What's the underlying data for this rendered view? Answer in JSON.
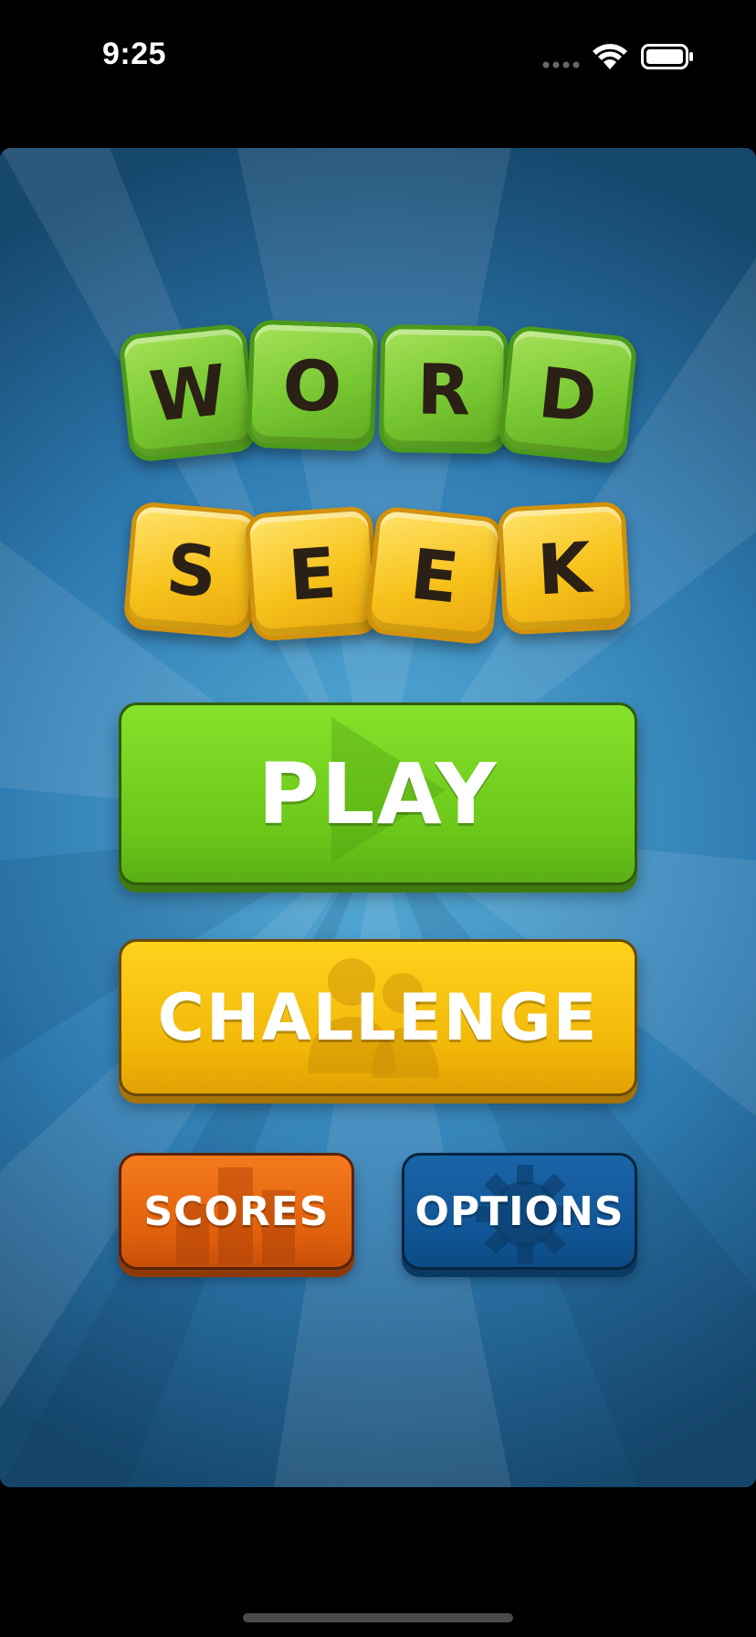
{
  "status_bar": {
    "time": "9:25",
    "icons": [
      "cellular-signal-icon",
      "wifi-icon",
      "battery-icon"
    ]
  },
  "logo": {
    "row1": [
      "W",
      "O",
      "R",
      "D"
    ],
    "row2": [
      "S",
      "E",
      "E",
      "K"
    ],
    "row1_color": "#78c832",
    "row2_color": "#f7c21c"
  },
  "buttons": {
    "play": {
      "label": "PLAY",
      "icon": "play-triangle-icon",
      "color": "#6bc81a"
    },
    "challenge": {
      "label": "CHALLENGE",
      "icon": "people-icon",
      "color": "#f2b708"
    },
    "scores": {
      "label": "SCORES",
      "icon": "bar-chart-icon",
      "color": "#e0600c"
    },
    "options": {
      "label": "OPTIONS",
      "icon": "gear-icon",
      "color": "#105595"
    }
  },
  "colors": {
    "background_blue": "#2f7cb3",
    "tile_letter": "#2b2015"
  }
}
